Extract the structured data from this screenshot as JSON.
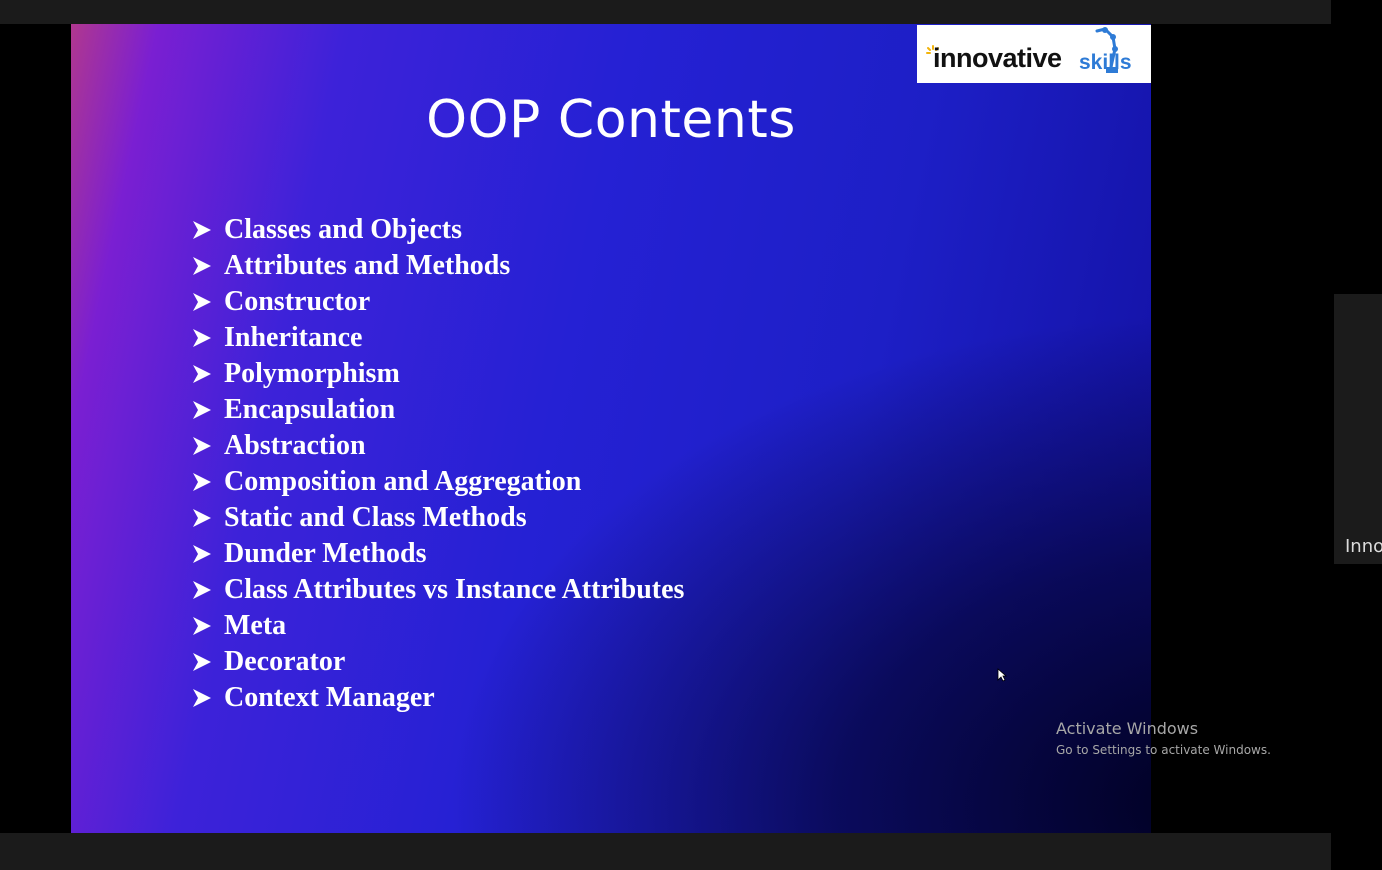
{
  "slide": {
    "title": "OOP Contents",
    "items": [
      "Classes and Objects",
      "Attributes and Methods",
      "Constructor",
      "Inheritance",
      "Polymorphism",
      "Encapsulation",
      "Abstraction",
      "Composition and Aggregation",
      "Static and Class Methods",
      "Dunder Methods",
      "Class Attributes vs Instance Attributes",
      "Meta",
      "Decorator",
      "Context Manager"
    ],
    "bullet_icon": "arrow-bullet-icon"
  },
  "logo": {
    "text_primary": "innovative",
    "text_secondary": "skills",
    "brand_color": "#2e7bd6"
  },
  "watermark": {
    "title": "Activate Windows",
    "subtitle": "Go to Settings to activate Windows."
  },
  "side_panel": {
    "label": "Inno"
  },
  "colors": {
    "slide_gradient_start": "#b0378f",
    "slide_gradient_mid": "#2521d4",
    "slide_gradient_end": "#1210a0",
    "text": "#ffffff"
  }
}
